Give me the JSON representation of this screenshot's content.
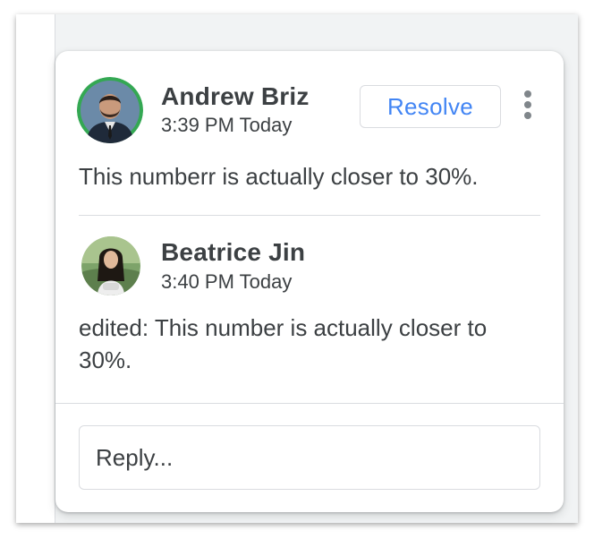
{
  "comments": [
    {
      "author": "Andrew Briz",
      "time": "3:39 PM Today",
      "text": "This numberr is actually closer to 30%.",
      "avatar_ring_color": "#34a853"
    },
    {
      "author": "Beatrice Jin",
      "time": "3:40 PM Today",
      "text": "edited: This number is actually closer to 30%."
    }
  ],
  "actions": {
    "resolve_label": "Resolve",
    "more_icon": "more-vertical-icon"
  },
  "reply": {
    "placeholder": "Reply..."
  },
  "colors": {
    "accent": "#4285f4",
    "text": "#3c4043",
    "divider": "#dadce0"
  }
}
